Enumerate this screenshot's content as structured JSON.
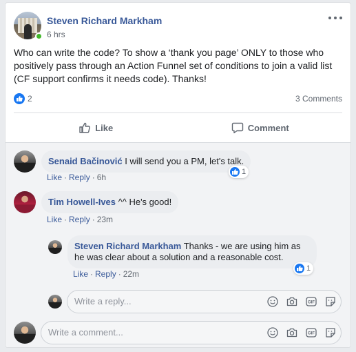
{
  "post": {
    "author": "Steven Richard Markham",
    "time": "6 hrs",
    "text": "Who can write the code? To show a ‘thank you page’ ONLY to those who positively pass through an Action Funnel set of conditions to join a valid list (CF support confirms it needs code). Thanks!",
    "like_count": "2",
    "comment_count": "3 Comments"
  },
  "actions": {
    "like": "Like",
    "comment": "Comment"
  },
  "comments": [
    {
      "name": "Senaid Bačinović",
      "text": "I will send you a PM, let's talk.",
      "like": "Like",
      "reply": "Reply",
      "time": "6h",
      "reactions": "1"
    },
    {
      "name": "Tim Howell-Ives",
      "text": "^^ He's good!",
      "like": "Like",
      "reply": "Reply",
      "time": "23m"
    }
  ],
  "reply": {
    "name": "Steven Richard Markham",
    "text": "Thanks - we are using him as he was clear about a solution and a reasonable cost.",
    "like": "Like",
    "reply": "Reply",
    "time": "22m",
    "reactions": "1"
  },
  "reply_input": {
    "placeholder": "Write a reply..."
  },
  "comment_input": {
    "placeholder": "Write a comment..."
  },
  "icons": {
    "input_icons": [
      "emoji-icon",
      "camera-icon",
      "gif-icon",
      "sticker-icon"
    ]
  },
  "colors": {
    "link": "#385898",
    "like_blue": "#1877f2",
    "online": "#42b72a"
  }
}
